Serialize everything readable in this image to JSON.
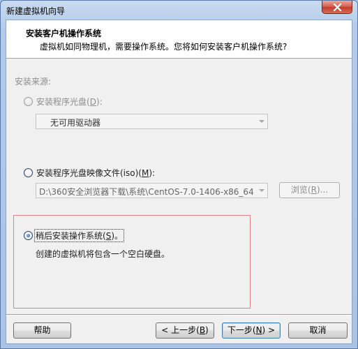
{
  "window": {
    "title": "新建虚拟机向导"
  },
  "header": {
    "title": "安装客户机操作系统",
    "subtitle": "虚拟机如同物理机，需要操作系统。您将如何安装客户机操作系统?"
  },
  "install_source": {
    "label": "安装来源:",
    "disc": {
      "label_pre": "安装程序光盘(",
      "accel": "D",
      "label_post": "):",
      "selected": false,
      "enabled": false,
      "combo_value": "无可用驱动器"
    },
    "iso": {
      "label_pre": "安装程序光盘映像文件(iso)(",
      "accel": "M",
      "label_post": "):",
      "selected": false,
      "enabled": true,
      "path_value": "D:\\360安全浏览器下载\\系统\\CentOS-7.0-1406-x86_64-D",
      "browse_pre": "浏览(",
      "browse_accel": "R",
      "browse_post": ")..."
    },
    "later": {
      "label_pre": "稍后安装操作系统(",
      "accel": "S",
      "label_post": ")。",
      "selected": true,
      "enabled": true,
      "description": "创建的虚拟机将包含一个空白硬盘。"
    }
  },
  "footer": {
    "help": "帮助",
    "back_pre": "< 上一步(",
    "back_accel": "B",
    "back_post": ")",
    "next_pre": "下一步(",
    "next_accel": "N",
    "next_post": ") >",
    "cancel": "取消"
  },
  "colors": {
    "highlight_border": "#e08282",
    "titlebar": "#b9d1ea",
    "close_button": "#c94a3a"
  }
}
